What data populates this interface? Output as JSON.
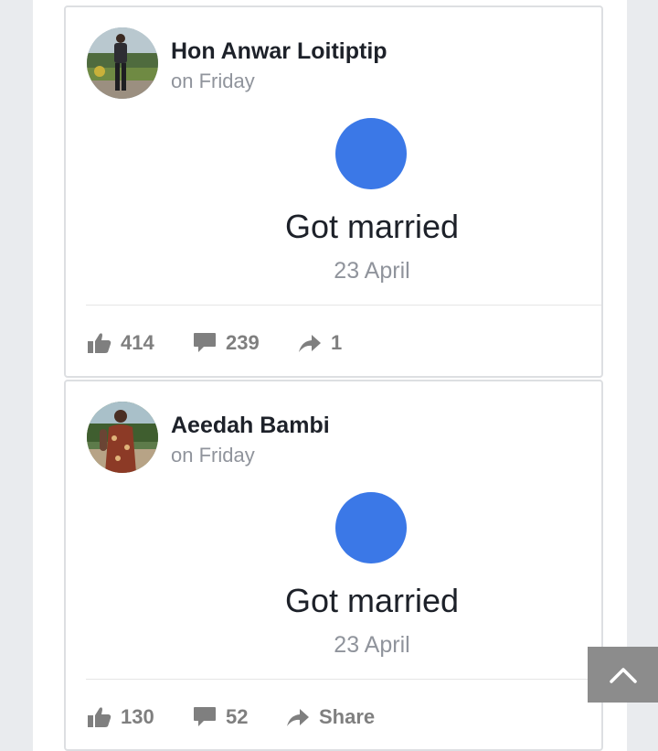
{
  "posts": [
    {
      "author": "Hon Anwar Loitiptip",
      "time": "on Friday",
      "event_title": "Got married",
      "event_date": "23 April",
      "likes": "414",
      "comments": "239",
      "shares": "1"
    },
    {
      "author": "Aeedah Bambi",
      "time": "on Friday",
      "event_title": "Got married",
      "event_date": "23 April",
      "likes": "130",
      "comments": "52",
      "shares": "Share"
    }
  ],
  "colors": {
    "event_dot": "#3b78e7",
    "page_bg": "#e9ebee",
    "action_gray": "#7f7f7f",
    "scroll_button": "#8c8c8c"
  },
  "icons": [
    "like-icon",
    "comment-icon",
    "share-icon",
    "chevron-up-icon"
  ]
}
